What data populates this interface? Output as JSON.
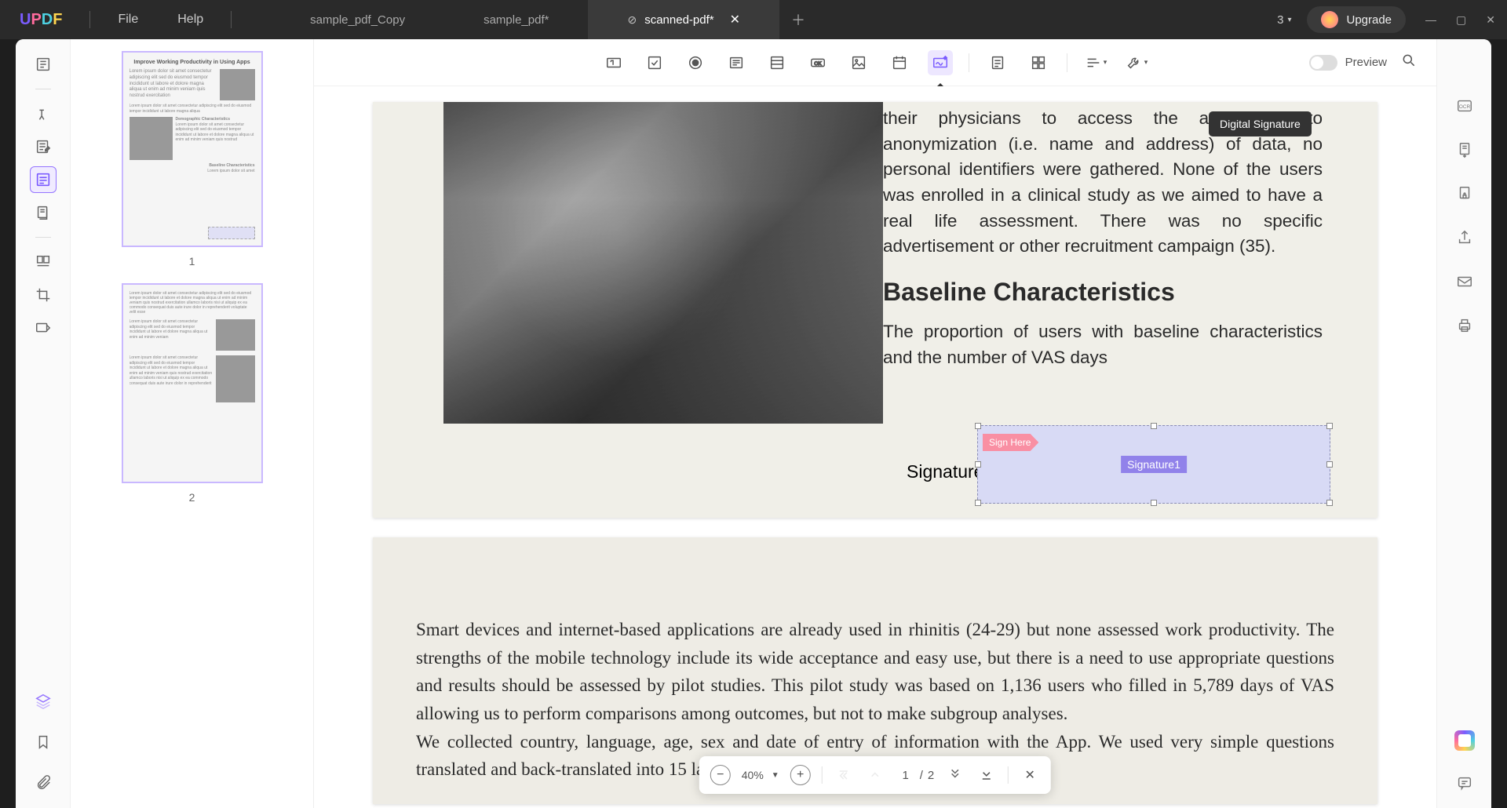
{
  "app": {
    "logo": "UPDF",
    "menu": {
      "file": "File",
      "help": "Help"
    },
    "tabs": [
      {
        "label": "sample_pdf_Copy",
        "active": false
      },
      {
        "label": "sample_pdf*",
        "active": false
      },
      {
        "label": "scanned-pdf*",
        "active": true,
        "icon": "disabled"
      }
    ],
    "count": "3",
    "upgrade": "Upgrade"
  },
  "tooltip": "Digital Signature",
  "preview_label": "Preview",
  "thumbnails": {
    "page1_title": "Improve Working Productivity in Using Apps",
    "page1_num": "1",
    "page2_num": "2",
    "section1": "Demographic Characteristics",
    "section2": "Baseline Characteristics"
  },
  "doc": {
    "page1": {
      "paragraph1": "their physicians to access the app. Due to anonymization (i.e. name and address) of data, no personal identifiers were gathered. None of the users was enrolled in a clinical study as we aimed to have a real life assessment. There was no specific advertisement or other recruitment campaign (35).",
      "heading": "Baseline Characteristics",
      "paragraph2": "The proportion of users with baseline characteristics and the number of VAS days",
      "signature_label": "Signature:",
      "sign_here": "Sign Here",
      "sig_name": "Signature1"
    },
    "page2": {
      "paragraph1": "Smart devices and internet-based applications are already used in rhinitis (24-29) but none assessed work productivity. The strengths of the mobile technology include its wide acceptance and easy use, but there is a need to use appropriate questions and results should be assessed by pilot studies. This pilot study was based on 1,136 users who filled in 5,789 days of VAS allowing us to perform comparisons among outcomes, but not to make subgroup analyses.",
      "paragraph2": "We collected country, language, age, sex and date of entry of information with the App. We used very simple questions translated and back-translated into 15 languages."
    }
  },
  "controls": {
    "zoom": "40%",
    "page_current": "1",
    "page_sep": "/",
    "page_total": "2"
  }
}
